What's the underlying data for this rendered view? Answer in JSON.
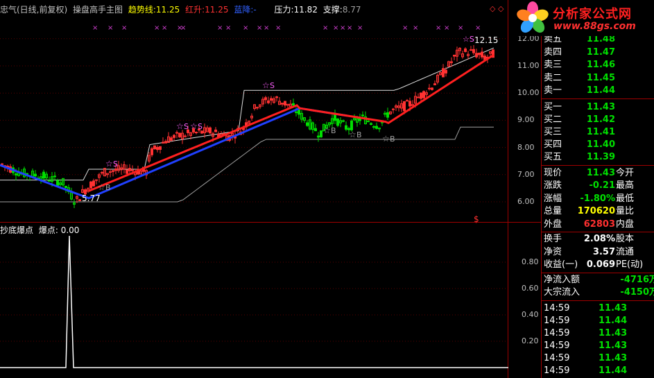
{
  "header": {
    "title": "忠气(日线,前复权)",
    "indicator": "操盘高手主图",
    "trend_label": "趋势线:",
    "trend_value": "11.25",
    "red_label": "红升:",
    "red_value": "11.25",
    "blue_label": "蓝降:",
    "blue_value": "-",
    "pressure_label": "压力:",
    "pressure_value": "11.82",
    "support_label": "支撑:",
    "support_value": "8.77"
  },
  "sub_header": {
    "title": "抄底爆点",
    "label": "爆点:",
    "value": "0.00"
  },
  "chart_annotations": {
    "high_label": "12.15",
    "low_label": "5.77",
    "buy_marker": "B",
    "sell_marker": "S"
  },
  "price_axis": [
    "12.00",
    "11.00",
    "10.00",
    "9.00",
    "8.00",
    "7.00",
    "6.00"
  ],
  "sub_axis": [
    "0.80",
    "0.60",
    "0.40",
    "0.20"
  ],
  "logo": {
    "text": "分析家公式网",
    "url": "www.88gs.com"
  },
  "quote_panel": {
    "asks": [
      {
        "label": "卖五",
        "price": "11.48"
      },
      {
        "label": "卖四",
        "price": "11.47"
      },
      {
        "label": "卖三",
        "price": "11.46"
      },
      {
        "label": "卖二",
        "price": "11.45"
      },
      {
        "label": "卖一",
        "price": "11.44"
      }
    ],
    "bids": [
      {
        "label": "买一",
        "price": "11.43"
      },
      {
        "label": "买二",
        "price": "11.42"
      },
      {
        "label": "买三",
        "price": "11.41"
      },
      {
        "label": "买四",
        "price": "11.40"
      },
      {
        "label": "买五",
        "price": "11.39"
      }
    ],
    "stats": [
      {
        "label": "现价",
        "value": "11.43",
        "label2": "今开"
      },
      {
        "label": "涨跌",
        "value": "-0.21",
        "label2": "最高"
      },
      {
        "label": "涨幅",
        "value": "-1.80%",
        "label2": "最低"
      },
      {
        "label": "总量",
        "value": "170620",
        "label2": "量比"
      },
      {
        "label": "外盘",
        "value": "62803",
        "label2": "内盘"
      },
      {
        "label": "换手",
        "value": "2.08%",
        "label2": "股本"
      },
      {
        "label": "净资",
        "value": "3.57",
        "label2": "流通"
      },
      {
        "label": "收益(一)",
        "value": "0.069",
        "label2": "PE(动)"
      }
    ],
    "flows": [
      {
        "label": "净流入额",
        "value": "-4716万"
      },
      {
        "label": "大宗流入",
        "value": "-4150万"
      }
    ],
    "ticks": [
      {
        "time": "14:59",
        "price": "11.43"
      },
      {
        "time": "14:59",
        "price": "11.44"
      },
      {
        "time": "14:59",
        "price": "11.43"
      },
      {
        "time": "14:59",
        "price": "11.43"
      },
      {
        "time": "14:59",
        "price": "11.43"
      },
      {
        "time": "14:59",
        "price": "11.44"
      }
    ]
  },
  "colors": {
    "up": "#ff3232",
    "down": "#00e000",
    "trend_up": "#ff2020",
    "trend_down": "#2040ff",
    "accent": "#ffff00"
  }
}
